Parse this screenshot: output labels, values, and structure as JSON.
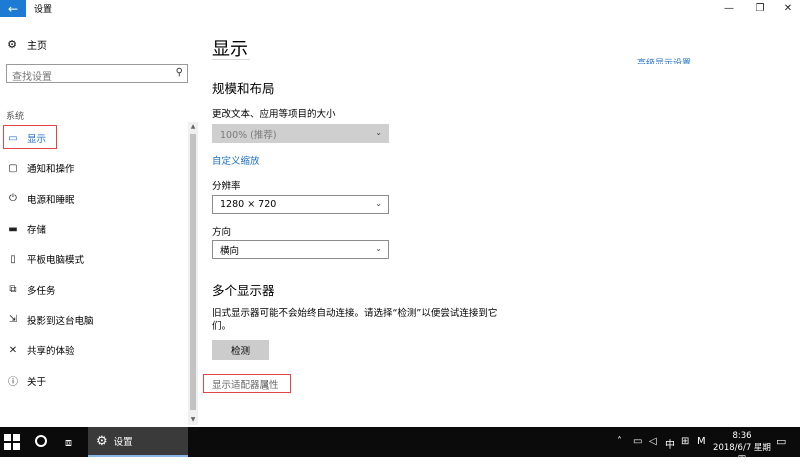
{
  "window": {
    "title": "设置",
    "back_icon": "←",
    "min_icon": "—",
    "max_icon": "❐",
    "close_icon": "✕"
  },
  "sidebar": {
    "home_label": "主页",
    "search_placeholder": "查找设置",
    "section_label": "系统",
    "items": [
      {
        "label": "显示",
        "icon": "monitor-icon",
        "active": true
      },
      {
        "label": "通知和操作",
        "icon": "notification-icon"
      },
      {
        "label": "电源和睡眠",
        "icon": "power-icon"
      },
      {
        "label": "存储",
        "icon": "storage-icon"
      },
      {
        "label": "平板电脑模式",
        "icon": "tablet-mode-icon"
      },
      {
        "label": "多任务",
        "icon": "multitasking-icon"
      },
      {
        "label": "投影到这台电脑",
        "icon": "project-icon"
      },
      {
        "label": "共享的体验",
        "icon": "shared-experiences-icon"
      },
      {
        "label": "关于",
        "icon": "info-icon"
      }
    ]
  },
  "main": {
    "title": "显示",
    "top_link": "高级显示设置",
    "layout_heading": "规模和布局",
    "scale_label": "更改文本、应用等项目的大小",
    "scale_value": "100% (推荐)",
    "custom_scale_link": "自定义缩放",
    "resolution_label": "分辨率",
    "resolution_value": "1280 × 720",
    "orientation_label": "方向",
    "orientation_value": "横向",
    "multi_heading": "多个显示器",
    "multi_desc": "旧式显示器可能不会始终自动连接。请选择“检测”以便尝试连接到它们。",
    "detect_label": "检测",
    "adapter_link": "显示适配器属性"
  },
  "taskbar": {
    "app_label": "设置",
    "ime_label": "中",
    "m_label": "M",
    "time": "8:36",
    "date": "2018/6/7 星期四"
  },
  "colors": {
    "accent": "#1e6fc8",
    "highlight_box": "#e34545",
    "taskbar": "#0b0b0b"
  }
}
